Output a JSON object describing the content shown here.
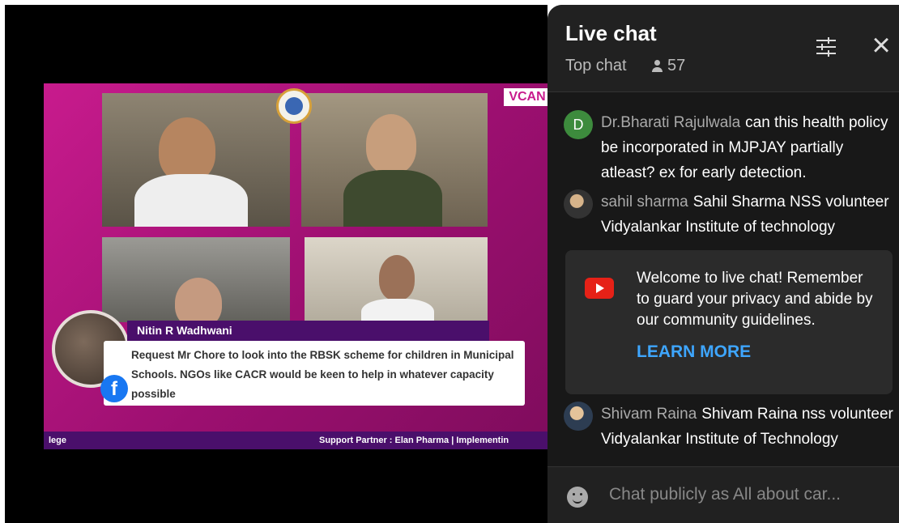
{
  "video": {
    "speaker_name": "Nitin R Wadhwani",
    "comment_text": "Request Mr Chore to look into the RBSK scheme for children in Municipal Schools. NGOs like CACR would be keen to help in whatever capacity possible",
    "logo_text": "VCAN",
    "ticker_left": "lege",
    "ticker_right": "Support Partner : Elan Pharma | Implementin",
    "fb_glyph": "f"
  },
  "chat": {
    "title": "Live chat",
    "mode": "Top chat",
    "viewer_count": "57",
    "messages": [
      {
        "avatar": "D",
        "author": "Dr.Bharati Rajulwala",
        "text": "can this health policy be incorporated in MJPJAY partially atleast? ex for early detection."
      },
      {
        "author": "sahil sharma",
        "text": "Sahil Sharma NSS volunteer Vidyalankar Institute of technology"
      },
      {
        "author": "Shivam Raina",
        "text": "Shivam Raina nss volunteer Vidyalankar Institute of Technology"
      }
    ],
    "welcome": {
      "text": "Welcome to live chat! Remember to guard your privacy and abide by our community guidelines.",
      "link": "LEARN MORE"
    },
    "input_placeholder": "Chat publicly as All about car..."
  },
  "colors": {
    "accent_link": "#3ea6ff",
    "stage_magenta": "#c81b8d",
    "youtube_red": "#e62117"
  }
}
